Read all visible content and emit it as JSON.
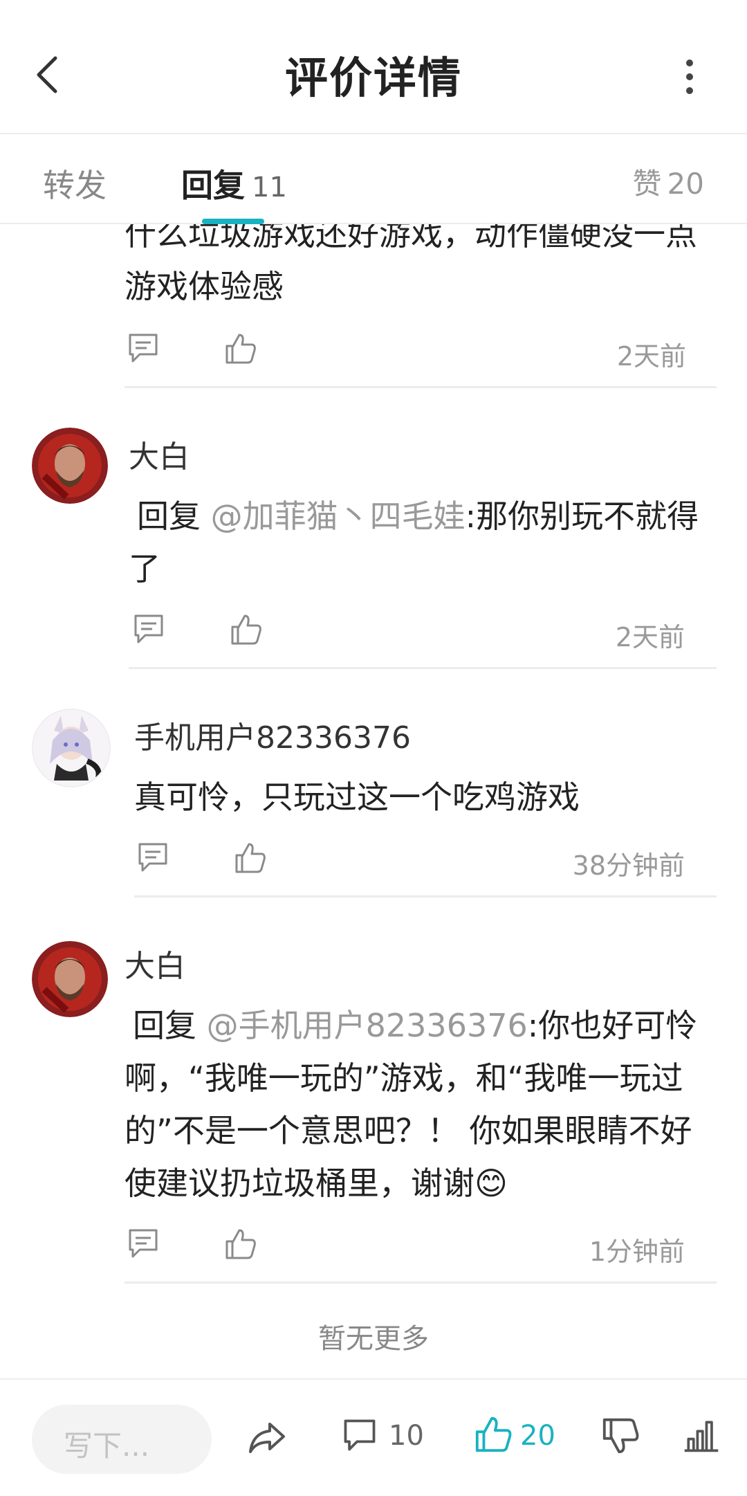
{
  "header": {
    "title": "评价详情"
  },
  "tabs": {
    "forward": "转发",
    "reply_label": "回复",
    "reply_count": "11",
    "likes_label": "赞",
    "likes_count": "20"
  },
  "comments": [
    {
      "text": "什么垃圾游戏还好游戏，动作僵硬没一点游戏体验感",
      "time": "2天前"
    },
    {
      "name": "大白",
      "reply_prefix": "回复",
      "mention": "@加菲猫丶四毛娃",
      "text": ":那你别玩不就得了",
      "time": "2天前"
    },
    {
      "name": "手机用户82336376",
      "text": "真可怜，只玩过这一个吃鸡游戏",
      "time": "38分钟前"
    },
    {
      "name": "大白",
      "reply_prefix": "回复",
      "mention": "@手机用户82336376",
      "text": ":你也好可怜啊，“我唯一玩的”游戏，和“我唯一玩过的”不是一个意思吧？！ 你如果眼睛不好使建议扔垃圾桶里，谢谢😊",
      "time": "1分钟前"
    }
  ],
  "no_more": "暂无更多",
  "bottom_bar": {
    "input_placeholder": "写下...",
    "comment_count": "10",
    "like_count": "20"
  },
  "colors": {
    "accent": "#19b2c2"
  }
}
